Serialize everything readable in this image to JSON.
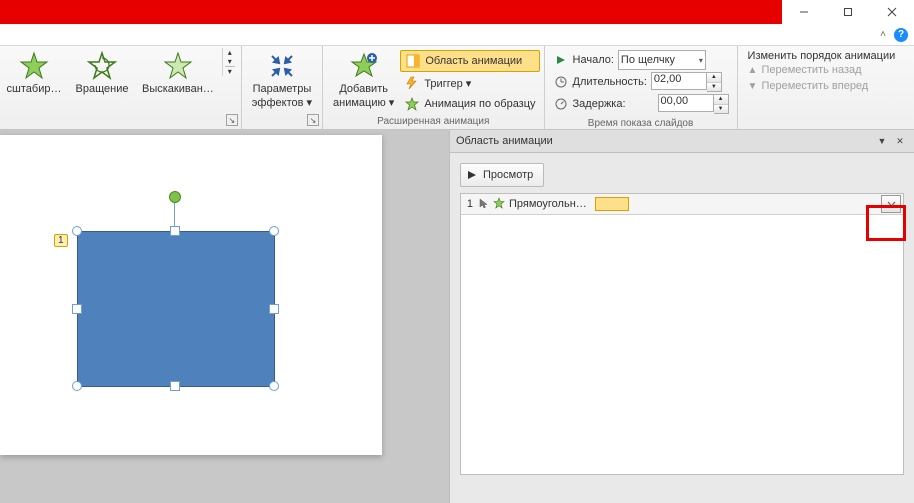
{
  "titlebar": {
    "minimize": "—",
    "maximize": "▢",
    "close": "✕"
  },
  "help": {
    "expand": "˄",
    "q": "?"
  },
  "ribbon": {
    "effects": {
      "btn1": "сштабир…",
      "btn2": "Вращение",
      "btn3": "Выскакиван…",
      "more": "▾"
    },
    "effect_options": {
      "label_line1": "Параметры",
      "label_line2": "эффектов ▾",
      "group_label": ""
    },
    "advanced": {
      "add_line1": "Добавить",
      "add_line2": "анимацию ▾",
      "pane": "Область анимации",
      "trigger": "Триггер ▾",
      "painter": "Анимация по образцу",
      "group_label": "Расширенная анимация"
    },
    "timing": {
      "start_label": "Начало:",
      "start_value": "По щелчку",
      "duration_label": "Длительность:",
      "duration_value": "02,00",
      "delay_label": "Задержка:",
      "delay_value": "00,00",
      "group_label": "Время показа слайдов"
    },
    "reorder": {
      "title": "Изменить порядок анимации",
      "back": "Переместить назад",
      "forward": "Переместить вперед"
    }
  },
  "canvas": {
    "tag": "1"
  },
  "pane": {
    "title": "Область анимации",
    "play": "Просмотр",
    "item": {
      "index": "1",
      "name": "Прямоугольн…"
    }
  }
}
